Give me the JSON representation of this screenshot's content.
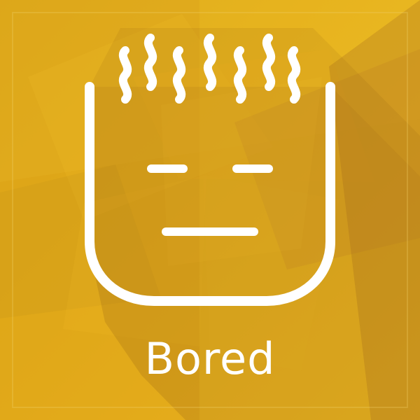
{
  "emotion_card": {
    "label": "Bored",
    "icon": "bored-face-icon",
    "colors": {
      "background_primary": "#f2b91f",
      "background_secondary": "#c58a24",
      "foreground": "#ffffff",
      "shadow": "#9a6a1a"
    }
  }
}
